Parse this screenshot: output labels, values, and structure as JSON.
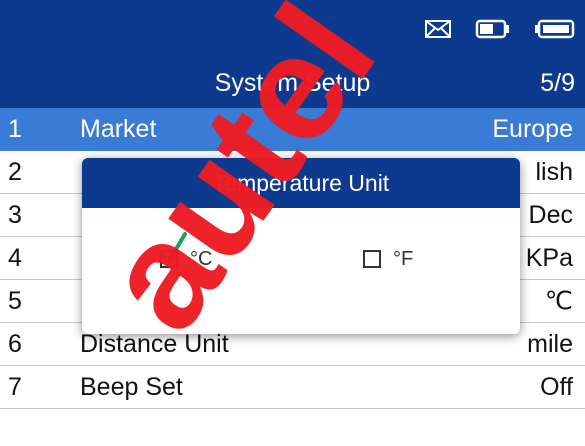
{
  "header": {
    "title": "System Setup",
    "page": "5/9"
  },
  "status_icons": [
    "mail-icon",
    "battery-icon",
    "battery-level-icon"
  ],
  "menu": {
    "items": [
      {
        "num": "1",
        "label": "Market",
        "value": "Europe",
        "selected": true
      },
      {
        "num": "2",
        "label": "",
        "value": "lish"
      },
      {
        "num": "3",
        "label": "",
        "value": "Dec"
      },
      {
        "num": "4",
        "label": "",
        "value": "KPa"
      },
      {
        "num": "5",
        "label": "",
        "value": "℃"
      },
      {
        "num": "6",
        "label": "Distance Unit",
        "value": "mile"
      },
      {
        "num": "7",
        "label": "Beep Set",
        "value": "Off"
      }
    ]
  },
  "dialog": {
    "title": "Temperature Unit",
    "options": [
      {
        "label": "°C",
        "checked": true
      },
      {
        "label": "°F",
        "checked": false
      }
    ]
  },
  "watermark": {
    "text": "autel"
  },
  "colors": {
    "header": "#0d3a8e",
    "selected": "#3a7bd5",
    "check": "#1aa05a"
  }
}
